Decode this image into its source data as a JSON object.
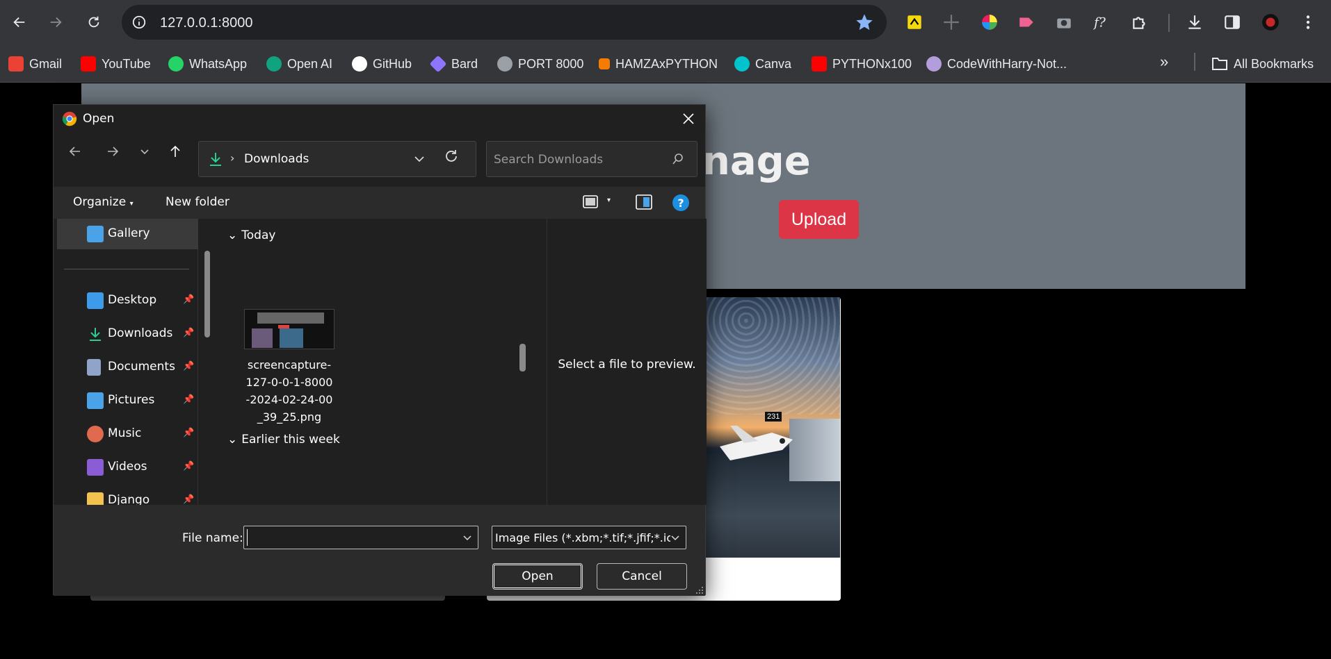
{
  "browser": {
    "url": "127.0.0.1:8000",
    "bookmarks": [
      {
        "label": "Gmail",
        "color": "#ea4335"
      },
      {
        "label": "YouTube",
        "color": "#ff0000"
      },
      {
        "label": "WhatsApp",
        "color": "#25d366"
      },
      {
        "label": "Open AI",
        "color": "#10a37f"
      },
      {
        "label": "GitHub",
        "color": "#ffffff"
      },
      {
        "label": "Bard",
        "color": "#8e75ff"
      },
      {
        "label": "PORT 8000",
        "color": "#9aa0a6"
      },
      {
        "label": "HAMZAxPYTHON",
        "color": "#f57c00"
      },
      {
        "label": "Canva",
        "color": "#00c4cc"
      },
      {
        "label": "PYTHONx100",
        "color": "#ff0000"
      },
      {
        "label": "CodeWithHarry-Not...",
        "color": "#b39ddb"
      }
    ],
    "all_bookmarks": "All Bookmarks"
  },
  "page": {
    "title_partial": "nage",
    "upload_label": "Upload",
    "colors": {
      "header_bg": "#6c757d",
      "upload": "#dc3545"
    }
  },
  "dialog": {
    "title": "Open",
    "location": "Downloads",
    "search_placeholder": "Search Downloads",
    "organize": "Organize",
    "new_folder": "New folder",
    "help": "?",
    "nav_items": [
      {
        "label": "Gallery",
        "pinned": false,
        "icon": "gallery-icon",
        "color": "#4aa3e8"
      },
      {
        "label": "Desktop",
        "pinned": true,
        "icon": "desktop-icon",
        "color": "#3d9be9"
      },
      {
        "label": "Downloads",
        "pinned": true,
        "icon": "downloads-icon",
        "color": "#2dcf8f"
      },
      {
        "label": "Documents",
        "pinned": true,
        "icon": "documents-icon",
        "color": "#8fa4c8"
      },
      {
        "label": "Pictures",
        "pinned": true,
        "icon": "pictures-icon",
        "color": "#4aa3e8"
      },
      {
        "label": "Music",
        "pinned": true,
        "icon": "music-icon",
        "color": "#e06a4e"
      },
      {
        "label": "Videos",
        "pinned": true,
        "icon": "videos-icon",
        "color": "#8a5cd6"
      },
      {
        "label": "Django",
        "pinned": true,
        "icon": "folder-icon",
        "color": "#f2c14e"
      }
    ],
    "groups": {
      "today": "Today",
      "earlier": "Earlier this week"
    },
    "files": [
      {
        "name": "screencapture-127-0-0-1-8000-2024-02-24-00_39_25.png"
      }
    ],
    "preview_text": "Select a file to preview.",
    "file_name_label": "File name:",
    "file_name_value": "",
    "file_type": "Image Files (*.xbm;*.tif;*.jfif;*.icc",
    "open_label": "Open",
    "cancel_label": "Cancel"
  }
}
